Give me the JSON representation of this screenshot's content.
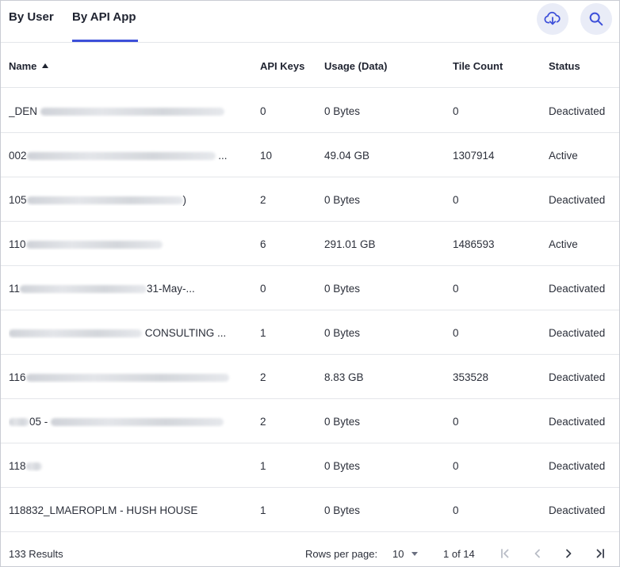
{
  "tabs": [
    {
      "label": "By User",
      "active": false
    },
    {
      "label": "By API App",
      "active": true
    }
  ],
  "toolbar": {
    "download_icon": "cloud-download-icon",
    "search_icon": "search-icon",
    "accent": "#3d4fd9"
  },
  "table": {
    "columns": [
      "Name",
      "API Keys",
      "Usage (Data)",
      "Tile Count",
      "Status"
    ],
    "sort": {
      "column": "Name",
      "direction": "ascending"
    },
    "rows": [
      {
        "name": "_DEN",
        "name_tail": "",
        "api_keys": "0",
        "usage": "0 Bytes",
        "tile_count": "0",
        "status": "Deactivated"
      },
      {
        "name": "002",
        "name_tail": "...",
        "api_keys": "10",
        "usage": "49.04 GB",
        "tile_count": "1307914",
        "status": "Active"
      },
      {
        "name": "105",
        "name_tail": ")",
        "api_keys": "2",
        "usage": "0 Bytes",
        "tile_count": "0",
        "status": "Deactivated"
      },
      {
        "name": "110",
        "name_tail": "",
        "api_keys": "6",
        "usage": "291.01 GB",
        "tile_count": "1486593",
        "status": "Active"
      },
      {
        "name": "11",
        "name_tail": "31-May-...",
        "api_keys": "0",
        "usage": "0 Bytes",
        "tile_count": "0",
        "status": "Deactivated"
      },
      {
        "name": "",
        "name_tail": "CONSULTING ...",
        "api_keys": "1",
        "usage": "0 Bytes",
        "tile_count": "0",
        "status": "Deactivated"
      },
      {
        "name": "116",
        "name_tail": "",
        "api_keys": "2",
        "usage": "8.83 GB",
        "tile_count": "353528",
        "status": "Deactivated"
      },
      {
        "name": "",
        "name_tail": "05 -",
        "api_keys": "2",
        "usage": "0 Bytes",
        "tile_count": "0",
        "status": "Deactivated"
      },
      {
        "name": "118",
        "name_tail": "",
        "api_keys": "1",
        "usage": "0 Bytes",
        "tile_count": "0",
        "status": "Deactivated"
      },
      {
        "name": "118832_LMAEROPLM - HUSH HOUSE",
        "name_tail": "",
        "api_keys": "1",
        "usage": "0 Bytes",
        "tile_count": "0",
        "status": "Deactivated"
      }
    ]
  },
  "footer": {
    "results": "133 Results",
    "rows_per_page_label": "Rows per page:",
    "rows_per_page_value": "10",
    "page_info": "1 of 14"
  }
}
